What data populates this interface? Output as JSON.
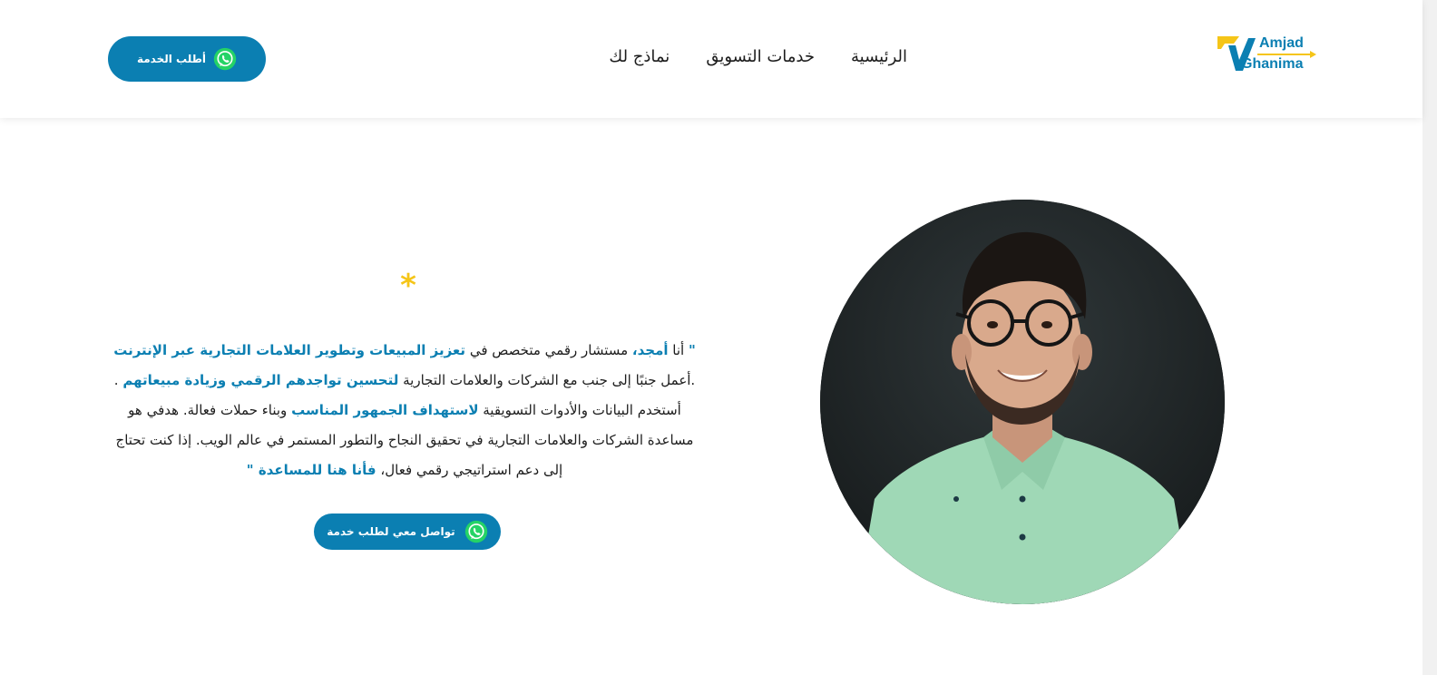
{
  "header": {
    "cta_label": "أطلب الخدمة",
    "nav": [
      {
        "label": "الرئيسية"
      },
      {
        "label": "خدمات التسويق"
      },
      {
        "label": "نماذج لك"
      }
    ],
    "logo": {
      "line1": "Amjad",
      "line2": "Ghanima"
    }
  },
  "hero": {
    "asterisk": "*",
    "bio": {
      "open_quote": "\"",
      "p1": " أنا ",
      "name": "أمجد،",
      "p2": " مستشار رقمي متخصص في ",
      "h1": "تعزيز المبيعات وتطوير العلامات التجارية عبر الإنترنت",
      "p3": " .أعمل جنبًا إلى جنب مع الشركات والعلامات التجارية ",
      "h2": "لتحسين تواجدهم الرقمي وزيادة مبيعاتهم",
      "p4": " . أستخدم البيانات والأدوات التسويقية ",
      "h3": "لاستهداف الجمهور المناسب",
      "p5": " وبناء حملات فعالة. هدفي هو مساعدة الشركات والعلامات التجارية في تحقيق النجاح والتطور المستمر في عالم الويب. إذا كنت تحتاج إلى دعم استراتيجي رقمي فعال، ",
      "h4": "فأنا هنا للمساعدة",
      "close_quote": " \""
    },
    "cta_label": "تواصل معي لطلب خدمة"
  },
  "colors": {
    "brand": "#0b7fb2",
    "accent": "#f5c518"
  }
}
